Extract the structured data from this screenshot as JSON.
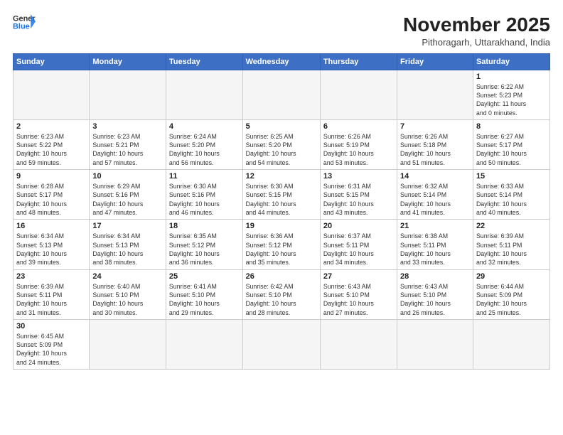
{
  "header": {
    "logo_general": "General",
    "logo_blue": "Blue",
    "month_title": "November 2025",
    "subtitle": "Pithoragarh, Uttarakhand, India"
  },
  "weekdays": [
    "Sunday",
    "Monday",
    "Tuesday",
    "Wednesday",
    "Thursday",
    "Friday",
    "Saturday"
  ],
  "weeks": [
    [
      {
        "day": "",
        "info": ""
      },
      {
        "day": "",
        "info": ""
      },
      {
        "day": "",
        "info": ""
      },
      {
        "day": "",
        "info": ""
      },
      {
        "day": "",
        "info": ""
      },
      {
        "day": "",
        "info": ""
      },
      {
        "day": "1",
        "info": "Sunrise: 6:22 AM\nSunset: 5:23 PM\nDaylight: 11 hours\nand 0 minutes."
      }
    ],
    [
      {
        "day": "2",
        "info": "Sunrise: 6:23 AM\nSunset: 5:22 PM\nDaylight: 10 hours\nand 59 minutes."
      },
      {
        "day": "3",
        "info": "Sunrise: 6:23 AM\nSunset: 5:21 PM\nDaylight: 10 hours\nand 57 minutes."
      },
      {
        "day": "4",
        "info": "Sunrise: 6:24 AM\nSunset: 5:20 PM\nDaylight: 10 hours\nand 56 minutes."
      },
      {
        "day": "5",
        "info": "Sunrise: 6:25 AM\nSunset: 5:20 PM\nDaylight: 10 hours\nand 54 minutes."
      },
      {
        "day": "6",
        "info": "Sunrise: 6:26 AM\nSunset: 5:19 PM\nDaylight: 10 hours\nand 53 minutes."
      },
      {
        "day": "7",
        "info": "Sunrise: 6:26 AM\nSunset: 5:18 PM\nDaylight: 10 hours\nand 51 minutes."
      },
      {
        "day": "8",
        "info": "Sunrise: 6:27 AM\nSunset: 5:17 PM\nDaylight: 10 hours\nand 50 minutes."
      }
    ],
    [
      {
        "day": "9",
        "info": "Sunrise: 6:28 AM\nSunset: 5:17 PM\nDaylight: 10 hours\nand 48 minutes."
      },
      {
        "day": "10",
        "info": "Sunrise: 6:29 AM\nSunset: 5:16 PM\nDaylight: 10 hours\nand 47 minutes."
      },
      {
        "day": "11",
        "info": "Sunrise: 6:30 AM\nSunset: 5:16 PM\nDaylight: 10 hours\nand 46 minutes."
      },
      {
        "day": "12",
        "info": "Sunrise: 6:30 AM\nSunset: 5:15 PM\nDaylight: 10 hours\nand 44 minutes."
      },
      {
        "day": "13",
        "info": "Sunrise: 6:31 AM\nSunset: 5:15 PM\nDaylight: 10 hours\nand 43 minutes."
      },
      {
        "day": "14",
        "info": "Sunrise: 6:32 AM\nSunset: 5:14 PM\nDaylight: 10 hours\nand 41 minutes."
      },
      {
        "day": "15",
        "info": "Sunrise: 6:33 AM\nSunset: 5:14 PM\nDaylight: 10 hours\nand 40 minutes."
      }
    ],
    [
      {
        "day": "16",
        "info": "Sunrise: 6:34 AM\nSunset: 5:13 PM\nDaylight: 10 hours\nand 39 minutes."
      },
      {
        "day": "17",
        "info": "Sunrise: 6:34 AM\nSunset: 5:13 PM\nDaylight: 10 hours\nand 38 minutes."
      },
      {
        "day": "18",
        "info": "Sunrise: 6:35 AM\nSunset: 5:12 PM\nDaylight: 10 hours\nand 36 minutes."
      },
      {
        "day": "19",
        "info": "Sunrise: 6:36 AM\nSunset: 5:12 PM\nDaylight: 10 hours\nand 35 minutes."
      },
      {
        "day": "20",
        "info": "Sunrise: 6:37 AM\nSunset: 5:11 PM\nDaylight: 10 hours\nand 34 minutes."
      },
      {
        "day": "21",
        "info": "Sunrise: 6:38 AM\nSunset: 5:11 PM\nDaylight: 10 hours\nand 33 minutes."
      },
      {
        "day": "22",
        "info": "Sunrise: 6:39 AM\nSunset: 5:11 PM\nDaylight: 10 hours\nand 32 minutes."
      }
    ],
    [
      {
        "day": "23",
        "info": "Sunrise: 6:39 AM\nSunset: 5:11 PM\nDaylight: 10 hours\nand 31 minutes."
      },
      {
        "day": "24",
        "info": "Sunrise: 6:40 AM\nSunset: 5:10 PM\nDaylight: 10 hours\nand 30 minutes."
      },
      {
        "day": "25",
        "info": "Sunrise: 6:41 AM\nSunset: 5:10 PM\nDaylight: 10 hours\nand 29 minutes."
      },
      {
        "day": "26",
        "info": "Sunrise: 6:42 AM\nSunset: 5:10 PM\nDaylight: 10 hours\nand 28 minutes."
      },
      {
        "day": "27",
        "info": "Sunrise: 6:43 AM\nSunset: 5:10 PM\nDaylight: 10 hours\nand 27 minutes."
      },
      {
        "day": "28",
        "info": "Sunrise: 6:43 AM\nSunset: 5:10 PM\nDaylight: 10 hours\nand 26 minutes."
      },
      {
        "day": "29",
        "info": "Sunrise: 6:44 AM\nSunset: 5:09 PM\nDaylight: 10 hours\nand 25 minutes."
      }
    ],
    [
      {
        "day": "30",
        "info": "Sunrise: 6:45 AM\nSunset: 5:09 PM\nDaylight: 10 hours\nand 24 minutes."
      },
      {
        "day": "",
        "info": ""
      },
      {
        "day": "",
        "info": ""
      },
      {
        "day": "",
        "info": ""
      },
      {
        "day": "",
        "info": ""
      },
      {
        "day": "",
        "info": ""
      },
      {
        "day": "",
        "info": ""
      }
    ]
  ]
}
